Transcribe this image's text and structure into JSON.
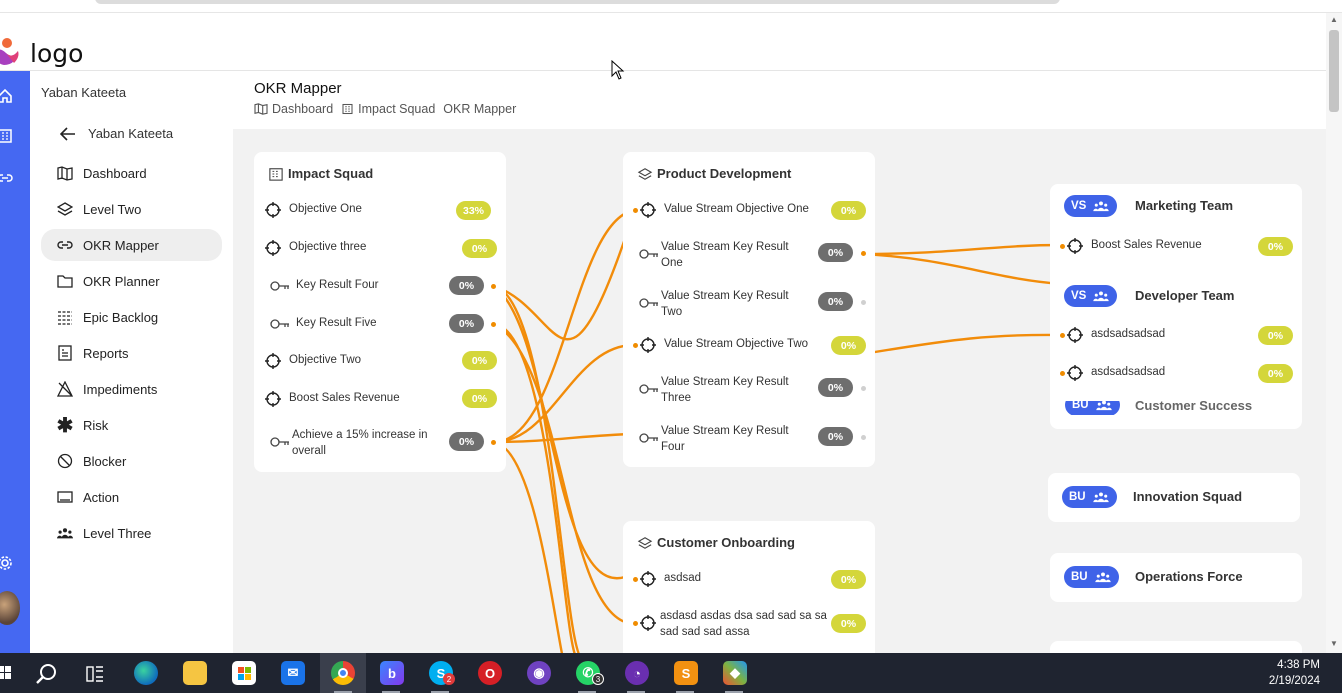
{
  "app": {
    "logo_text": "logo"
  },
  "sidebar": {
    "user": "Yaban Kateeta",
    "back_label": "Yaban Kateeta",
    "items": [
      {
        "label": "Dashboard",
        "icon": "map-icon"
      },
      {
        "label": "Level Two",
        "icon": "layers-icon"
      },
      {
        "label": "OKR Mapper",
        "icon": "link-icon",
        "active": true
      },
      {
        "label": "OKR Planner",
        "icon": "folder-icon"
      },
      {
        "label": "Epic Backlog",
        "icon": "list-icon"
      },
      {
        "label": "Reports",
        "icon": "report-icon"
      },
      {
        "label": "Impediments",
        "icon": "impediment-icon"
      },
      {
        "label": "Risk",
        "icon": "asterisk-icon"
      },
      {
        "label": "Blocker",
        "icon": "block-icon"
      },
      {
        "label": "Action",
        "icon": "monitor-icon"
      },
      {
        "label": "Level Three",
        "icon": "team-icon"
      }
    ]
  },
  "page": {
    "title": "OKR Mapper",
    "breadcrumbs": [
      "Dashboard",
      "Impact Squad",
      "OKR Mapper"
    ]
  },
  "cards": {
    "impact_squad": {
      "title": "Impact Squad",
      "rows": [
        {
          "label": "Objective One",
          "value": "33%",
          "kind": "objective",
          "tone": "y"
        },
        {
          "label": "Objective three",
          "value": "0%",
          "kind": "objective",
          "tone": "y"
        },
        {
          "label": "Key Result Four",
          "value": "0%",
          "kind": "kr",
          "tone": "g"
        },
        {
          "label": "Key Result Five",
          "value": "0%",
          "kind": "kr",
          "tone": "g"
        },
        {
          "label": "Objective Two",
          "value": "0%",
          "kind": "objective",
          "tone": "y"
        },
        {
          "label": "Boost Sales Revenue",
          "value": "0%",
          "kind": "objective",
          "tone": "y"
        },
        {
          "label": "Achieve a 15% increase in overall",
          "value": "0%",
          "kind": "kr",
          "tone": "g"
        }
      ]
    },
    "product_development": {
      "title": "Product Development",
      "rows": [
        {
          "label": "Value Stream Objective One",
          "value": "0%",
          "kind": "objective",
          "tone": "y"
        },
        {
          "label": "Value Stream Key Result One",
          "value": "0%",
          "kind": "kr",
          "tone": "g"
        },
        {
          "label": "Value Stream Key Result Two",
          "value": "0%",
          "kind": "kr",
          "tone": "g"
        },
        {
          "label": "Value Stream Objective Two",
          "value": "0%",
          "kind": "objective",
          "tone": "y"
        },
        {
          "label": "Value Stream Key Result Three",
          "value": "0%",
          "kind": "kr",
          "tone": "g"
        },
        {
          "label": "Value Stream Key Result Four",
          "value": "0%",
          "kind": "kr",
          "tone": "g"
        }
      ]
    },
    "customer_onboarding": {
      "title": "Customer Onboarding",
      "rows": [
        {
          "label": "asdsad",
          "value": "0%",
          "kind": "objective",
          "tone": "y"
        },
        {
          "label": "asdasd asdas dsa sad sad sa sa sad sad sad assa",
          "value": "0%",
          "kind": "objective",
          "tone": "y"
        }
      ]
    },
    "teams": {
      "marketing": {
        "badge": "VS",
        "name": "Marketing Team",
        "rows": [
          {
            "label": "Boost Sales Revenue",
            "value": "0%"
          }
        ]
      },
      "developer": {
        "badge": "VS",
        "name": "Developer Team",
        "rows": [
          {
            "label": "asdsadsadsad",
            "value": "0%"
          },
          {
            "label": "asdsadsadsad",
            "value": "0%"
          }
        ]
      },
      "customer_success": {
        "badge": "BU",
        "name": "Customer Success"
      },
      "innovation": {
        "badge": "BU",
        "name": "Innovation Squad"
      },
      "operations": {
        "badge": "BU",
        "name": "Operations Force"
      }
    }
  },
  "taskbar": {
    "time": "4:38 PM",
    "date": "2/19/2024",
    "skype_count": "2",
    "whatsapp_count": "3"
  },
  "colors": {
    "accent": "#4568f2",
    "link": "#f08c00",
    "yellow_pill": "#d4d63a",
    "grey_pill": "#6e6e6e"
  }
}
